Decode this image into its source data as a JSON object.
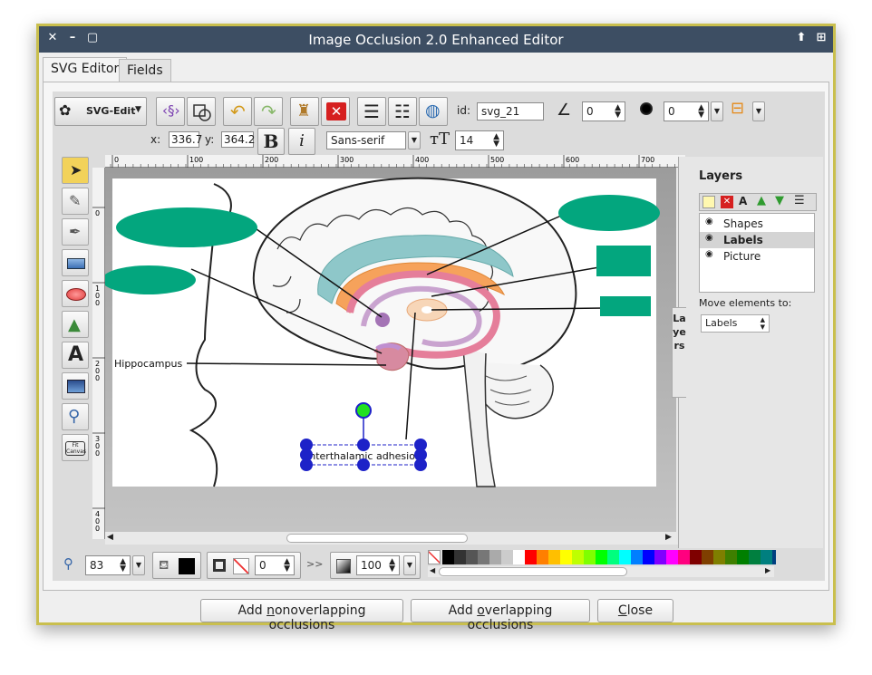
{
  "window": {
    "title": "Image Occlusion 2.0 Enhanced Editor",
    "controls": {
      "close": "✕",
      "minimize": "–",
      "maximize": "▢",
      "up": "⬆",
      "grid": "⊞"
    }
  },
  "tabs": [
    {
      "label": "SVG Editor",
      "active": true
    },
    {
      "label": "Fields",
      "active": false
    }
  ],
  "toolbar": {
    "svgedit_label": "SVG-Edit",
    "id_label": "id:",
    "id_value": "svg_21",
    "angle_value": "0",
    "blur_value": "0",
    "x_label": "x:",
    "x_value": "336.7",
    "y_label": "y:",
    "y_value": "364.2",
    "bold_label": "B",
    "italic_label": "i",
    "font_family": "Sans-serif",
    "font_size": "14"
  },
  "ruler": {
    "top_ticks": [
      "0",
      "100",
      "200",
      "300",
      "400",
      "500",
      "600",
      "700"
    ],
    "left_ticks": [
      "0",
      "100",
      "200",
      "300",
      "400"
    ]
  },
  "canvas": {
    "label_hippocampus": "Hippocampus",
    "label_selected": "Interthalamic adhesion"
  },
  "layers": {
    "heading": "Layers",
    "items": [
      {
        "name": "Shapes",
        "selected": false
      },
      {
        "name": "Labels",
        "selected": true
      },
      {
        "name": "Picture",
        "selected": false
      }
    ],
    "move_label": "Move elements to:",
    "move_value": "Labels",
    "side_tab": "Layers"
  },
  "bottom": {
    "zoom_value": "83",
    "stroke_width": "0",
    "opacity_value": "100",
    "more": ">>"
  },
  "palette": [
    "#000000",
    "#333333",
    "#555555",
    "#777777",
    "#aaaaaa",
    "#cccccc",
    "#ffffff",
    "#ff0000",
    "#ff7f00",
    "#ffbf00",
    "#ffff00",
    "#bfff00",
    "#7fff00",
    "#00ff00",
    "#00ff7f",
    "#00ffff",
    "#007fff",
    "#0000ff",
    "#7f00ff",
    "#ff00ff",
    "#ff007f",
    "#7f0000",
    "#7f3f00",
    "#7f7f00",
    "#3f7f00",
    "#007f00",
    "#007f3f",
    "#007f7f",
    "#003f7f"
  ],
  "footer": {
    "btn_nonoverlap_pre": "Add ",
    "btn_nonoverlap_u": "n",
    "btn_nonoverlap_post": "onoverlapping occlusions",
    "btn_overlap_pre": "Add ",
    "btn_overlap_u": "o",
    "btn_overlap_post": "verlapping occlusions",
    "btn_close_u": "C",
    "btn_close_post": "lose"
  },
  "colors": {
    "occlusion": "#03a67e",
    "titlebar": "#3d4e63",
    "window_border": "#c9bf4e",
    "handle": "#1d22c8"
  }
}
